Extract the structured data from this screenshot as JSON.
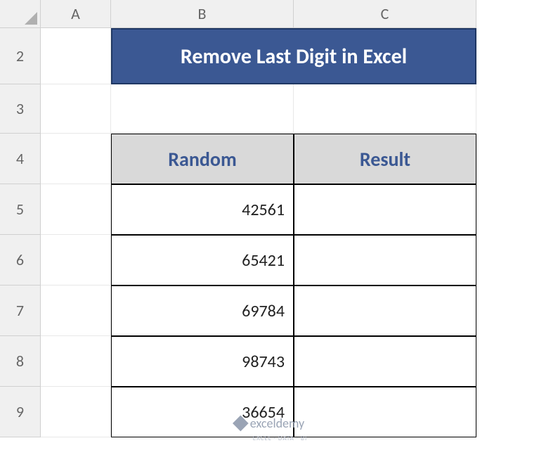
{
  "columns": [
    "A",
    "B",
    "C"
  ],
  "rows": [
    "2",
    "3",
    "4",
    "5",
    "6",
    "7",
    "8",
    "9"
  ],
  "title": "Remove Last Digit in Excel",
  "headers": {
    "random": "Random",
    "result": "Result"
  },
  "data": {
    "random": [
      "42561",
      "65421",
      "69784",
      "98743",
      "36654"
    ],
    "result": [
      "",
      "",
      "",
      "",
      ""
    ]
  },
  "watermark": {
    "text": "exceldemy",
    "sub": "EXCEL · DATA · BI"
  }
}
